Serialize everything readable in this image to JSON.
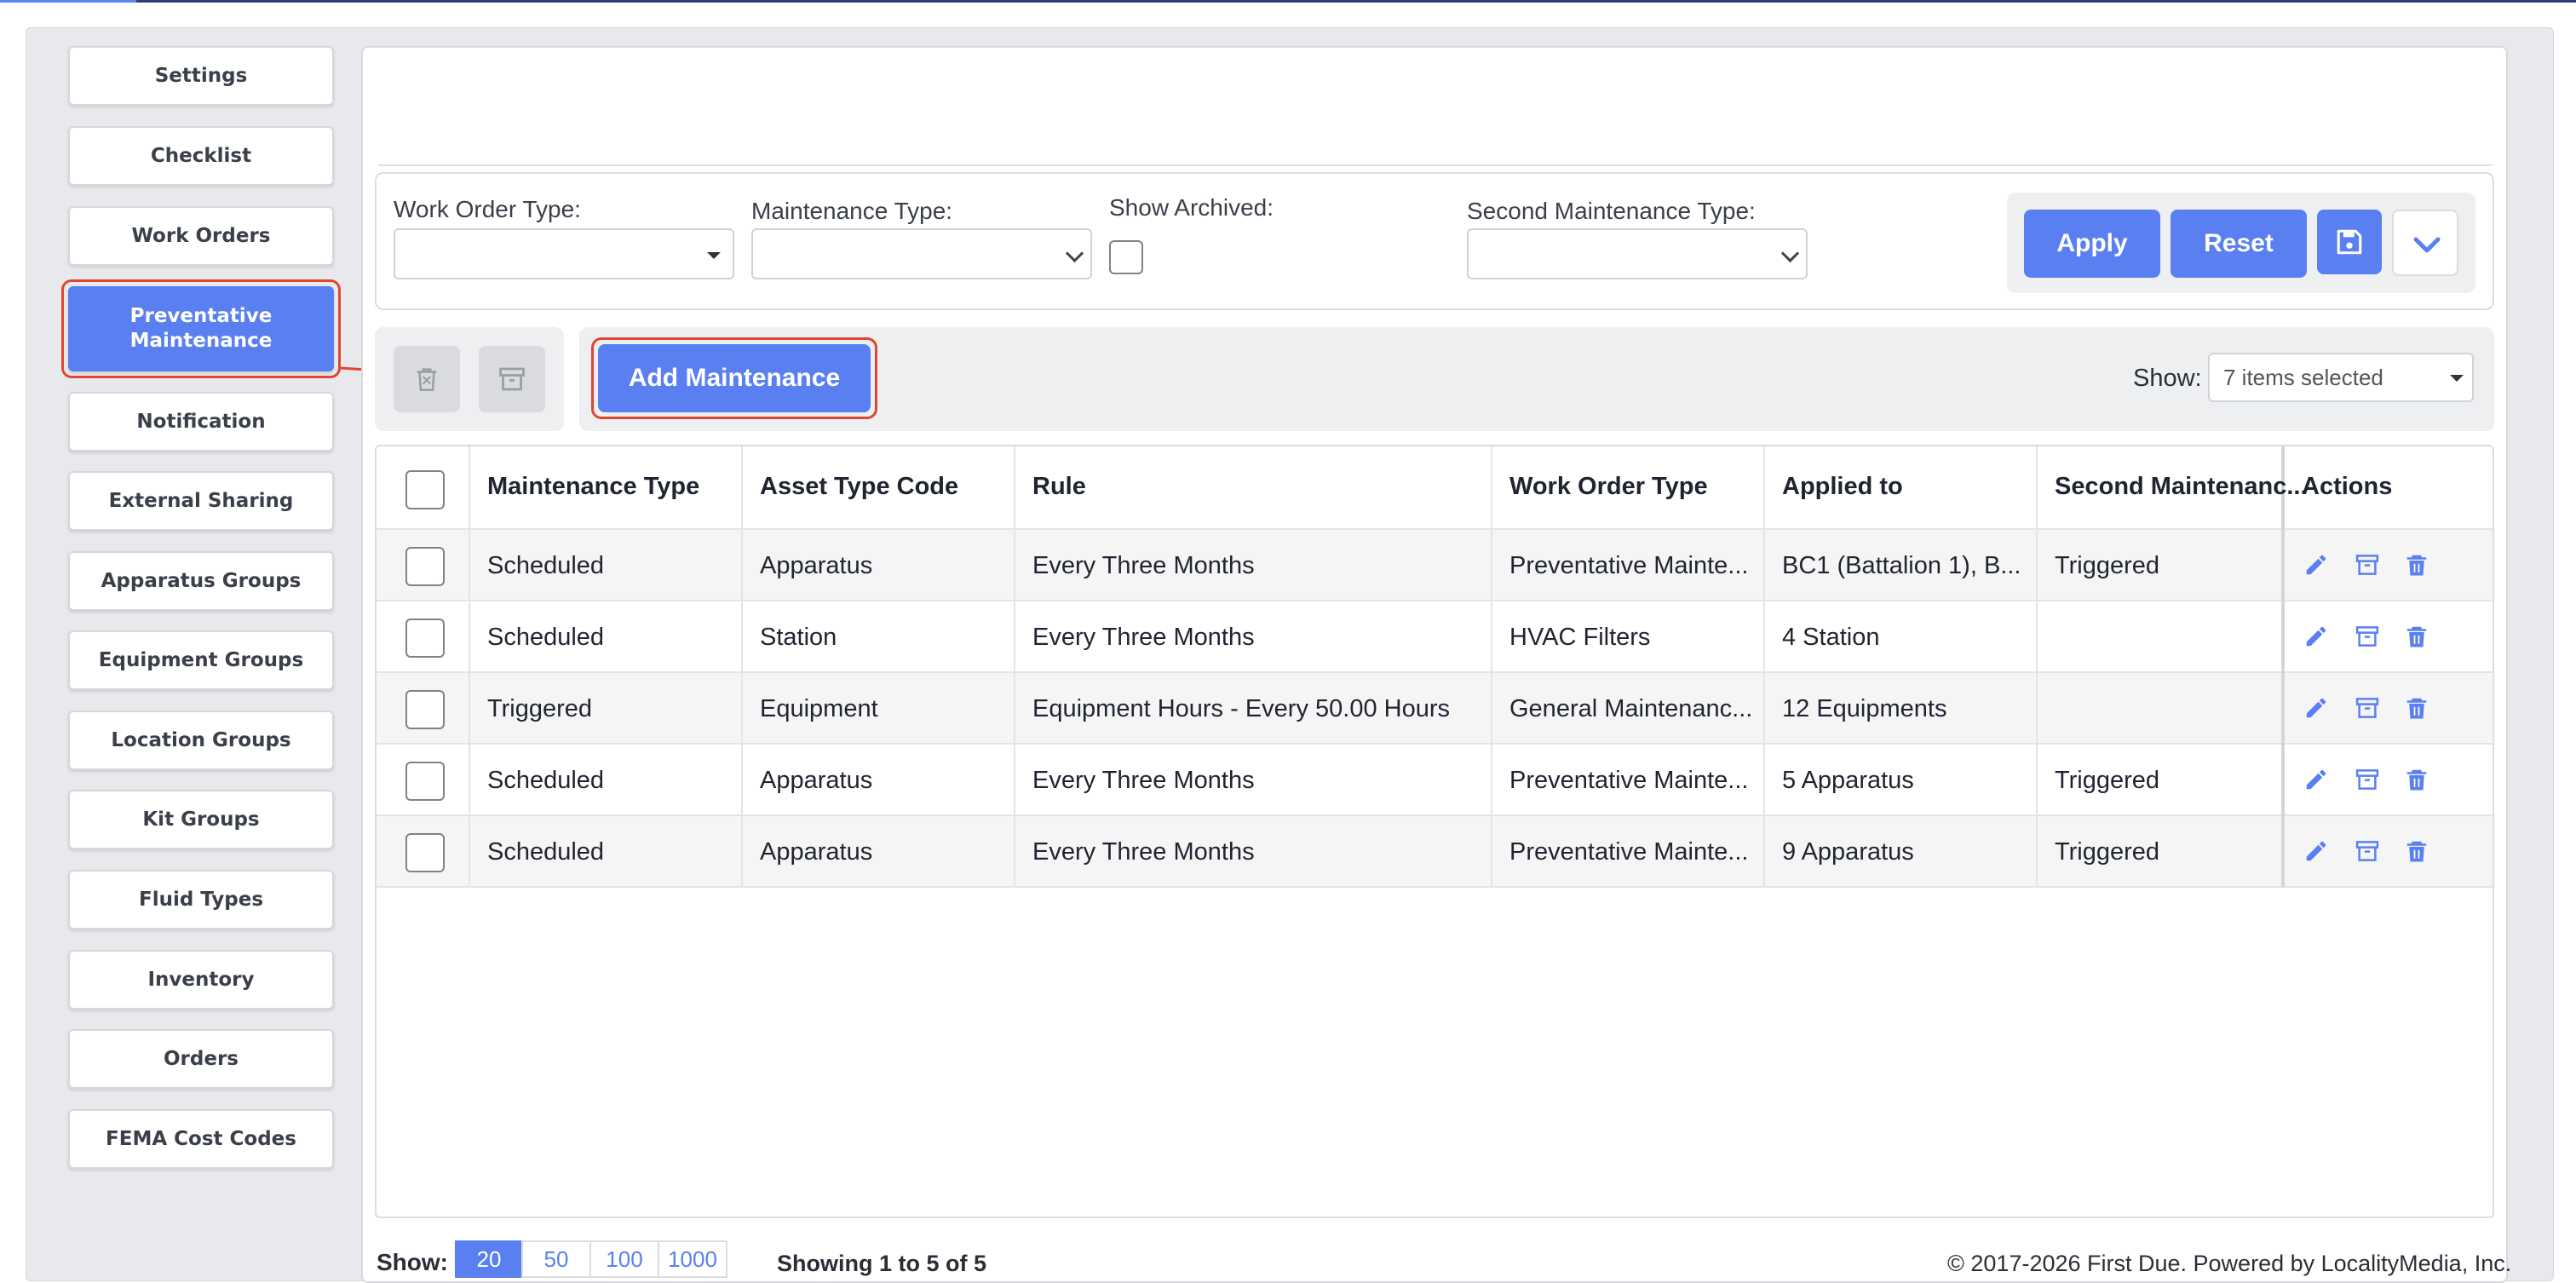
{
  "sidebar": {
    "items": [
      {
        "label": "Settings"
      },
      {
        "label": "Checklist"
      },
      {
        "label": "Work Orders"
      },
      {
        "label": "Preventative Maintenance",
        "active": true
      },
      {
        "label": "Notification"
      },
      {
        "label": "External Sharing"
      },
      {
        "label": "Apparatus Groups"
      },
      {
        "label": "Equipment Groups"
      },
      {
        "label": "Location Groups"
      },
      {
        "label": "Kit Groups"
      },
      {
        "label": "Fluid Types"
      },
      {
        "label": "Inventory"
      },
      {
        "label": "Orders"
      },
      {
        "label": "FEMA Cost Codes"
      }
    ]
  },
  "filters": {
    "work_order_type_label": "Work Order Type:",
    "work_order_type_value": "",
    "maintenance_type_label": "Maintenance Type:",
    "maintenance_type_value": "",
    "show_archived_label": "Show Archived:",
    "show_archived_checked": false,
    "second_maintenance_type_label": "Second Maintenance Type:",
    "second_maintenance_type_value": "",
    "apply_label": "Apply",
    "reset_label": "Reset"
  },
  "toolbar": {
    "add_label": "Add Maintenance",
    "show_label": "Show:",
    "show_value": "7 items selected"
  },
  "table": {
    "headers": [
      "Maintenance Type",
      "Asset Type Code",
      "Rule",
      "Work Order Type",
      "Applied to",
      "Second Maintenanc...",
      "Actions"
    ],
    "rows": [
      [
        "Scheduled",
        "Apparatus",
        "Every Three Months",
        "Preventative Mainte...",
        "BC1 (Battalion 1), B...",
        "Triggered"
      ],
      [
        "Scheduled",
        "Station",
        "Every Three Months",
        "HVAC Filters",
        "4 Station",
        ""
      ],
      [
        "Triggered",
        "Equipment",
        "Equipment Hours - Every 50.00 Hours",
        "General Maintenanc...",
        "12 Equipments",
        ""
      ],
      [
        "Scheduled",
        "Apparatus",
        "Every Three Months",
        "Preventative Mainte...",
        "5 Apparatus",
        "Triggered"
      ],
      [
        "Scheduled",
        "Apparatus",
        "Every Three Months",
        "Preventative Mainte...",
        "9 Apparatus",
        "Triggered"
      ]
    ]
  },
  "footer": {
    "show_label": "Show:",
    "page_sizes": [
      "20",
      "50",
      "100",
      "1000"
    ],
    "active_page_size": "20",
    "summary": "Showing 1 to 5 of 5",
    "copyright": "© 2017-2026 First Due. Powered by LocalityMedia, Inc."
  },
  "colors": {
    "accent": "#5a7ff0",
    "highlight": "#e0452f"
  }
}
